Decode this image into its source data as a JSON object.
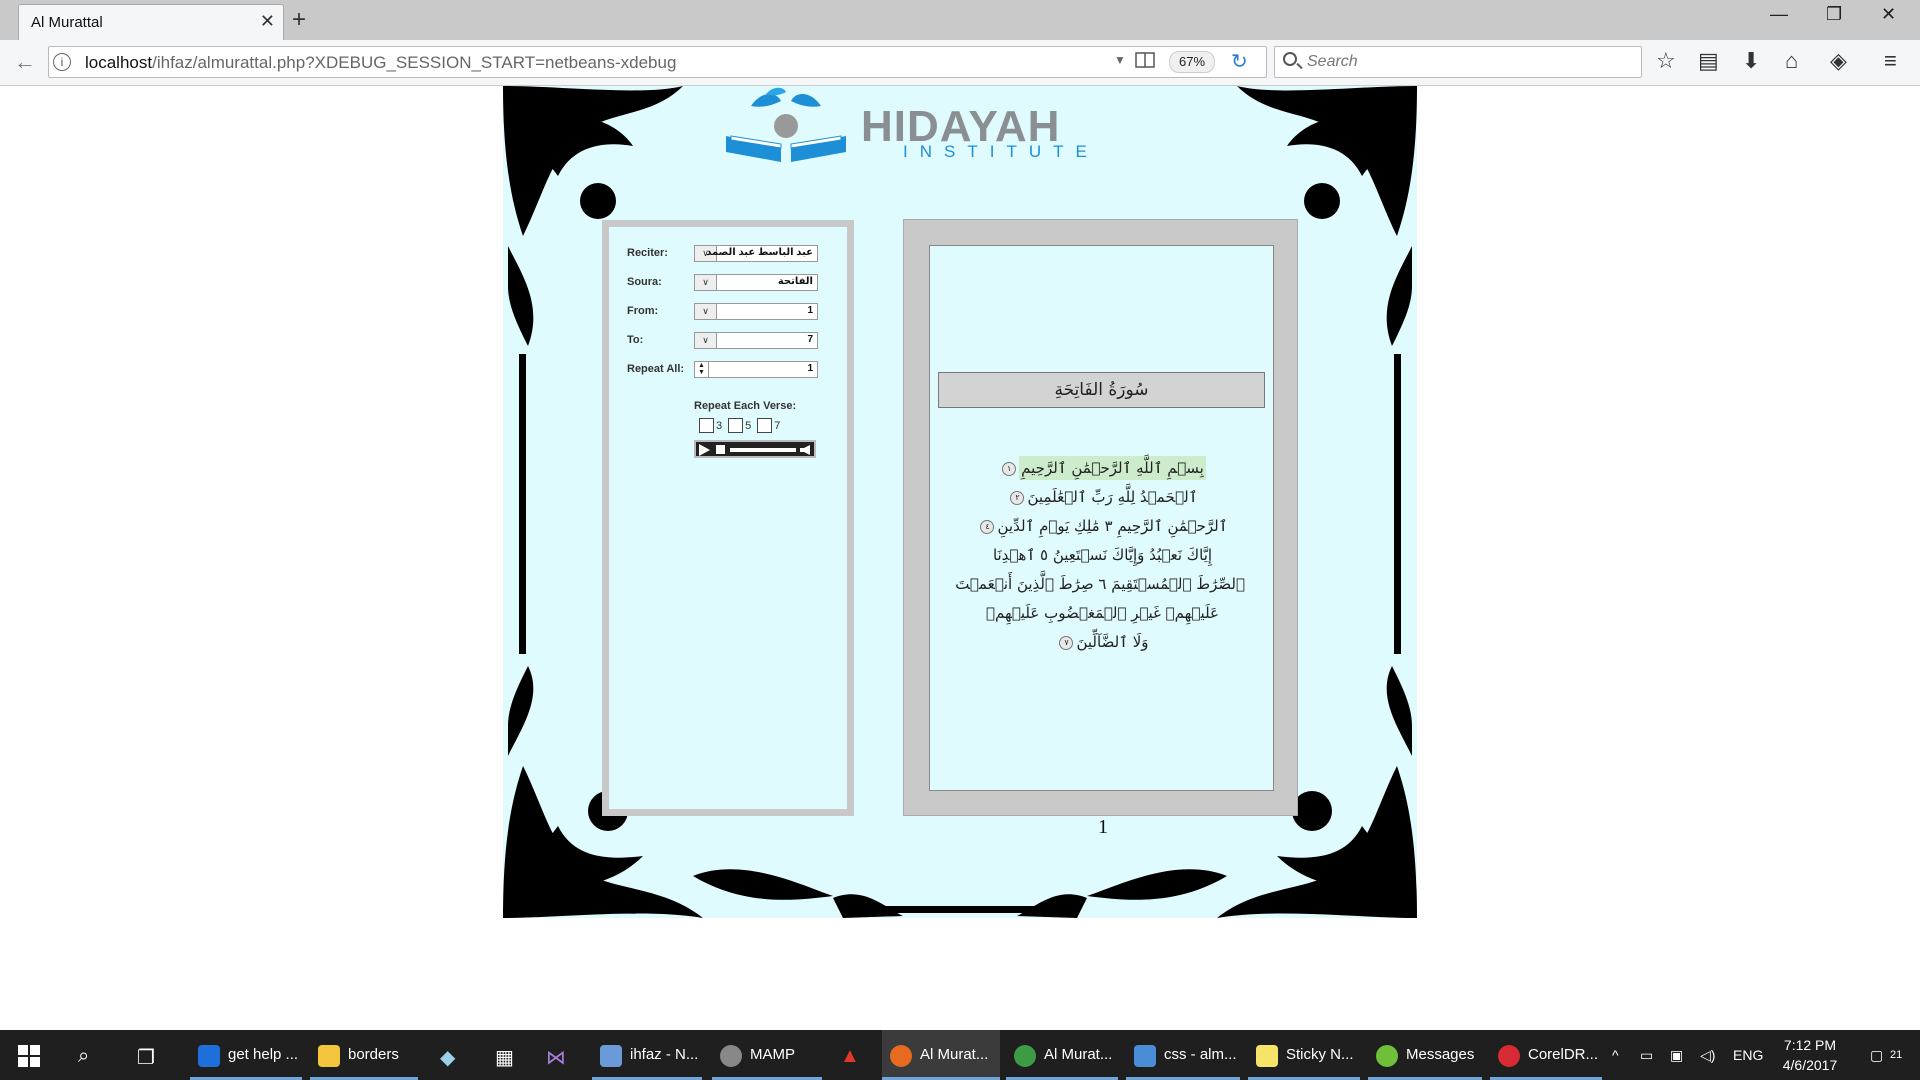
{
  "browser": {
    "tab_title": "Al Murattal",
    "url_host": "localhost",
    "url_path": "/ihfaz/almurattal.php?XDEBUG_SESSION_START=netbeans-xdebug",
    "zoom": "67%",
    "search_placeholder": "Search"
  },
  "logo": {
    "word": "HIDAYAH",
    "sub": "INSTITUTE"
  },
  "controls": {
    "reciter_label": "Reciter:",
    "reciter_value": "عبد الباسط عبد الصمد",
    "soura_label": "Soura:",
    "soura_value": "الفاتحة",
    "from_label": "From:",
    "from_value": "1",
    "to_label": "To:",
    "to_value": "7",
    "repeat_all_label": "Repeat All:",
    "repeat_all_value": "1",
    "repeat_each_label": "Repeat Each Verse:",
    "repeat_options": [
      "3",
      "5",
      "7"
    ]
  },
  "mushaf": {
    "surah_title": "سُورَةُ الفَاتِحَةِ",
    "lines": [
      {
        "text": "بِسۡمِ ٱللَّهِ ٱلرَّحۡمَٰنِ ٱلرَّحِيمِ",
        "mark": "١"
      },
      {
        "text": "ٱلۡحَمۡدُ لِلَّهِ رَبِّ ٱلۡعَٰلَمِينَ",
        "mark": "٢"
      },
      {
        "text": "ٱلرَّحۡمَٰنِ ٱلرَّحِيمِ ٣ مَٰلِكِ يَوۡمِ ٱلدِّينِ",
        "mark": "٤"
      },
      {
        "text": "إِيَّاكَ نَعۡبُدُ وَإِيَّاكَ نَسۡتَعِينُ ٥ ٱهۡدِنَا",
        "mark": ""
      },
      {
        "text": "ٱلصِّرَٰطَ ٱلۡمُسۡتَقِيمَ ٦ صِرَٰطَ ٱلَّذِينَ أَنۡعَمۡتَ",
        "mark": ""
      },
      {
        "text": "عَلَيۡهِمۡ غَيۡرِ ٱلۡمَغۡضُوبِ عَلَيۡهِمۡ",
        "mark": ""
      },
      {
        "text": "وَلَا ٱلضَّآلِّينَ",
        "mark": "٧"
      }
    ],
    "page_number": "1"
  },
  "taskbar": {
    "items": [
      "get help ...",
      "borders",
      "ihfaz - N...",
      "MAMP",
      "Al Murat...",
      "Al Murat...",
      "css - alm...",
      "Sticky N...",
      "Messages",
      "CorelDR..."
    ],
    "lang": "ENG",
    "time": "7:12 PM",
    "date": "4/6/2017",
    "notifications": "21"
  },
  "colors": {
    "page_bg": "#e0fbfd",
    "panel_border": "#c9c9c9",
    "highlight": "#cdeccc",
    "logo_blue": "#1d8fd6"
  }
}
